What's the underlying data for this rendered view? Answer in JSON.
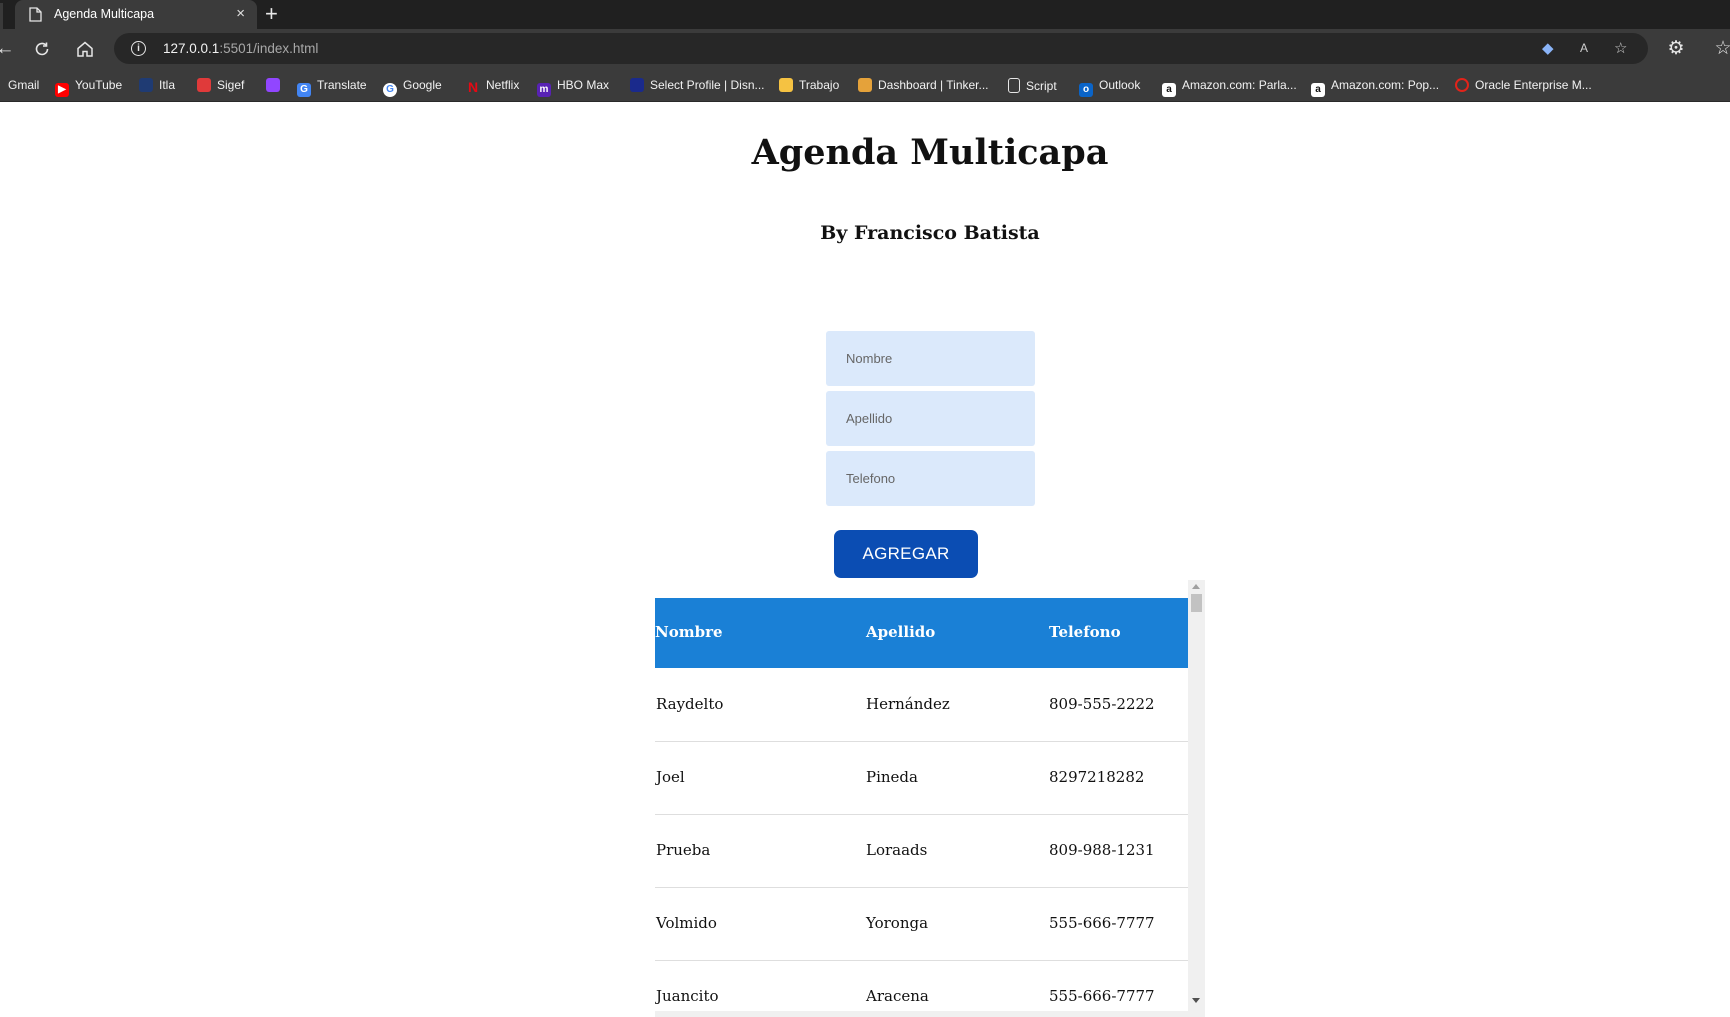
{
  "browser": {
    "tab_title": "Agenda Multicapa",
    "tab_close": "×",
    "new_tab": "+",
    "url_host": "127.0.0.1",
    "url_path": ":5501/index.html",
    "bookmarks": [
      {
        "label": "Gmail",
        "icon": "gmail-icon",
        "color": ""
      },
      {
        "label": "YouTube",
        "icon": "youtube-icon",
        "color": "#ff0000"
      },
      {
        "label": "Itla",
        "icon": "itla-icon",
        "color": "#1f3b73"
      },
      {
        "label": "Sigef",
        "icon": "sigef-icon",
        "color": "#e03a3a"
      },
      {
        "label": "",
        "icon": "twitch-icon",
        "color": "#9146ff"
      },
      {
        "label": "Translate",
        "icon": "translate-icon",
        "color": "#4285f4"
      },
      {
        "label": "Google",
        "icon": "google-icon",
        "color": "#ffffff"
      },
      {
        "label": "Netflix",
        "icon": "netflix-icon",
        "color": "#e50914"
      },
      {
        "label": "HBO Max",
        "icon": "hbomax-icon",
        "color": "#5822b4"
      },
      {
        "label": "Select Profile | Disn...",
        "icon": "disney-icon",
        "color": "#1a2a8c"
      },
      {
        "label": "Trabajo",
        "icon": "folder-icon",
        "color": "#f5c242"
      },
      {
        "label": "Dashboard | Tinker...",
        "icon": "tinkercad-icon",
        "color": "#e5a23a"
      },
      {
        "label": "Script",
        "icon": "page-icon",
        "color": ""
      },
      {
        "label": "Outlook",
        "icon": "outlook-icon",
        "color": "#0a64c8"
      },
      {
        "label": "Amazon.com: Parla...",
        "icon": "amazon-icon",
        "color": "#ffffff"
      },
      {
        "label": "Amazon.com: Pop...",
        "icon": "amazon-icon",
        "color": "#ffffff"
      },
      {
        "label": "Oracle Enterprise M...",
        "icon": "oracle-icon",
        "color": "#e2231a"
      }
    ]
  },
  "page": {
    "title": "Agenda Multicapa",
    "subtitle": "By Francisco Batista",
    "form": {
      "nombre_placeholder": "Nombre",
      "apellido_placeholder": "Apellido",
      "telefono_placeholder": "Telefono",
      "submit_label": "AGREGAR"
    },
    "table": {
      "headers": [
        "Nombre",
        "Apellido",
        "Telefono"
      ],
      "rows": [
        [
          "Raydelto",
          "Hernández",
          "809-555-2222"
        ],
        [
          "Joel",
          "Pineda",
          "8297218282"
        ],
        [
          "Prueba",
          "Loraads",
          "809-988-1231"
        ],
        [
          "Volmido",
          "Yoronga",
          "555-666-7777"
        ],
        [
          "Juancito",
          "Aracena",
          "555-666-7777"
        ]
      ]
    }
  },
  "colors": {
    "button": "#0b4db3",
    "table_header": "#1a80d6",
    "input_bg": "#dbe9fb"
  }
}
